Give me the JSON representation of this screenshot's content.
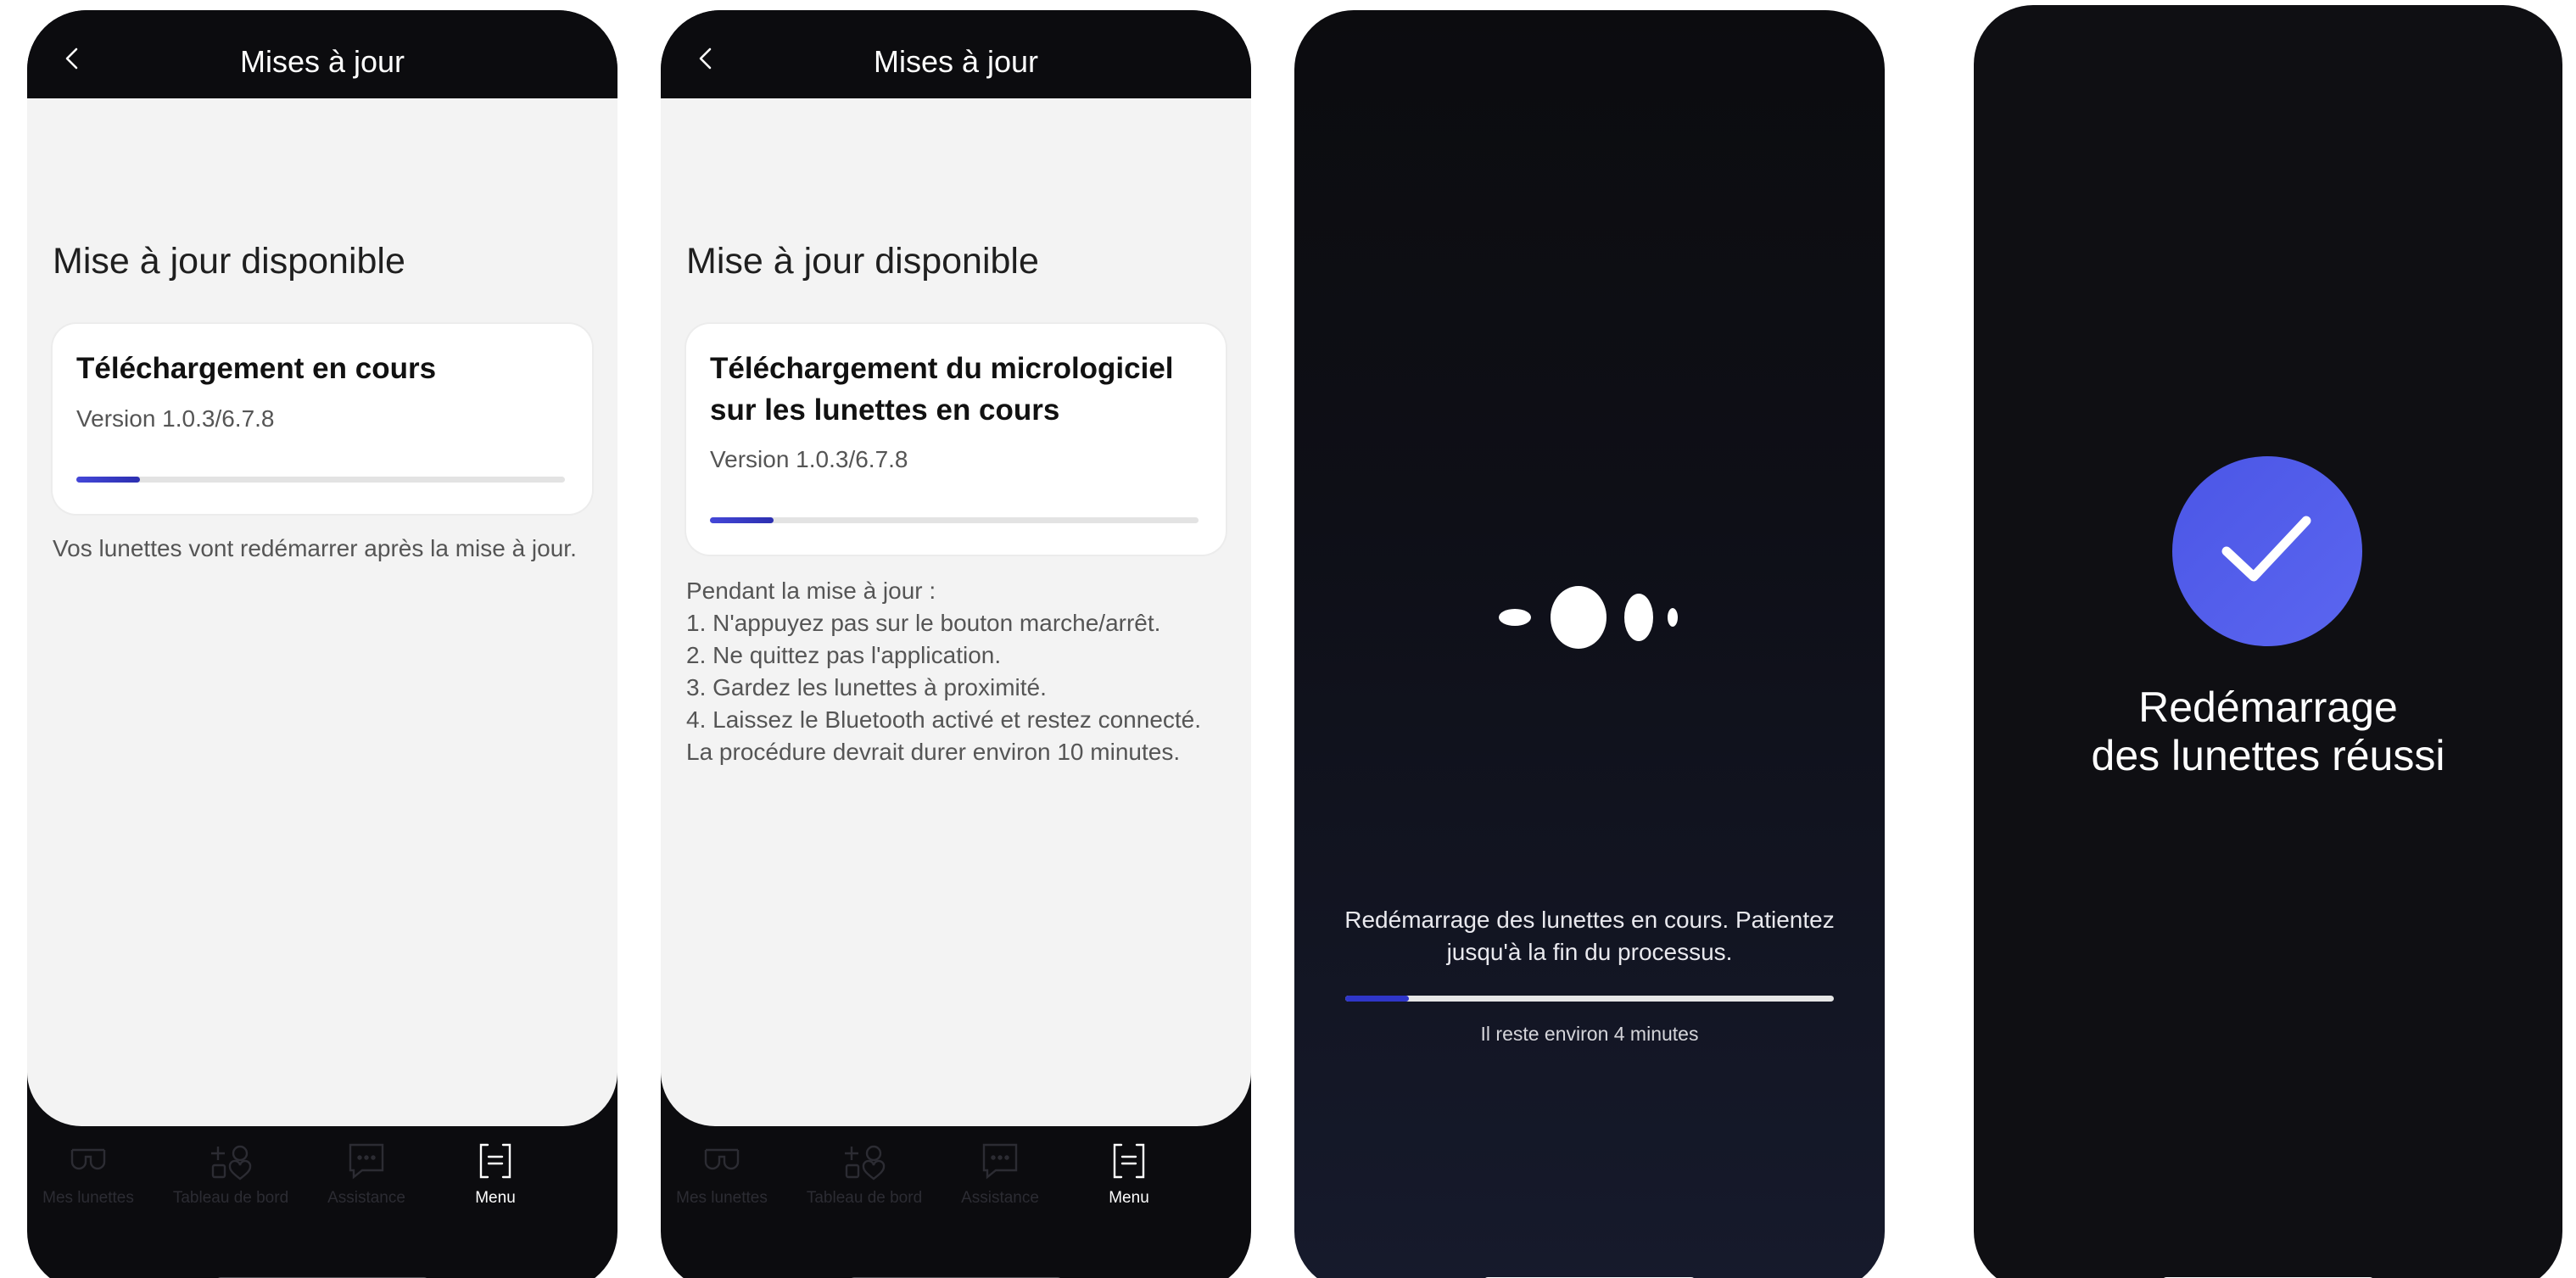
{
  "screens": [
    {
      "header": {
        "title": "Mises à jour"
      },
      "section_title": "Mise à jour disponible",
      "card": {
        "title": "Téléchargement en cours",
        "version": "Version 1.0.3/6.7.8",
        "progress_percent": 13
      },
      "note": "Vos lunettes vont redémarrer après la mise à jour.",
      "nav": [
        {
          "label": "Mes lunettes",
          "icon": "glasses-icon"
        },
        {
          "label": "Tableau de bord",
          "icon": "dashboard-icon"
        },
        {
          "label": "Assistance",
          "icon": "chat-icon"
        },
        {
          "label": "Menu",
          "icon": "menu-icon",
          "active": true
        }
      ]
    },
    {
      "header": {
        "title": "Mises à jour"
      },
      "section_title": "Mise à jour disponible",
      "card": {
        "title": "Téléchargement du micrologiciel sur les lunettes en cours",
        "version": "Version 1.0.3/6.7.8",
        "progress_percent": 13
      },
      "instructions": [
        "Pendant la mise à jour  :",
        "1. N'appuyez pas sur le bouton marche/arrêt.",
        "2. Ne quittez pas l'application.",
        "3. Gardez les lunettes à proximité.",
        "4. Laissez le Bluetooth activé et restez connecté.",
        "La procédure devrait durer environ 10 minutes."
      ],
      "nav": [
        {
          "label": "Mes lunettes",
          "icon": "glasses-icon"
        },
        {
          "label": "Tableau de bord",
          "icon": "dashboard-icon"
        },
        {
          "label": "Assistance",
          "icon": "chat-icon"
        },
        {
          "label": "Menu",
          "icon": "menu-icon",
          "active": true
        }
      ]
    },
    {
      "message": "Redémarrage des lunettes en cours. Patientez jusqu'à la fin du processus.",
      "progress_percent": 13,
      "time_left": "Il reste environ 4 minutes"
    },
    {
      "success_icon": "check-icon",
      "message": "Redémarrage des lunettes réussi"
    }
  ],
  "colors": {
    "accent": "#4b56e6",
    "progress": "#2f36c9",
    "dark_bg": "#0c0c0f",
    "light_bg": "#f3f3f3"
  }
}
